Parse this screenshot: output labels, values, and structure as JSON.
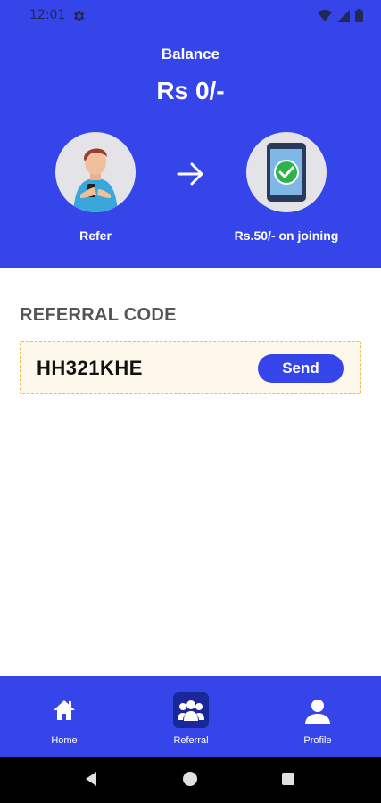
{
  "status_bar": {
    "time": "12:01"
  },
  "header": {
    "balance_label": "Balance",
    "balance_value": "Rs 0/-",
    "refer_caption": "Refer",
    "join_caption": "Rs.50/- on joining"
  },
  "referral": {
    "title": "REFERRAL CODE",
    "code": "HH321KHE",
    "send_label": "Send"
  },
  "bottom_nav": {
    "items": [
      {
        "label": "Home",
        "icon": "home-icon"
      },
      {
        "label": "Referral",
        "icon": "group-icon",
        "active": true
      },
      {
        "label": "Profile",
        "icon": "person-icon"
      }
    ]
  },
  "colors": {
    "primary": "#3545ea",
    "accent_border": "#f0b94a",
    "code_bg": "#fef8ec"
  }
}
